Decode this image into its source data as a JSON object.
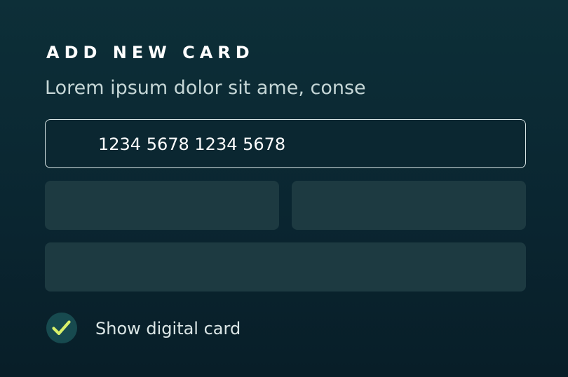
{
  "header": {
    "title": "ADD NEW CARD",
    "subtitle": "Lorem ipsum dolor sit ame, conse"
  },
  "form": {
    "card_number": "1234 5678 1234 5678"
  },
  "digital_card": {
    "label": "Show digital card",
    "checked": true,
    "check_icon": "check-icon"
  },
  "colors": {
    "accent": "#d8f06a",
    "checkbox_bg": "#174a4f",
    "field_bg": "#1d3a41"
  }
}
